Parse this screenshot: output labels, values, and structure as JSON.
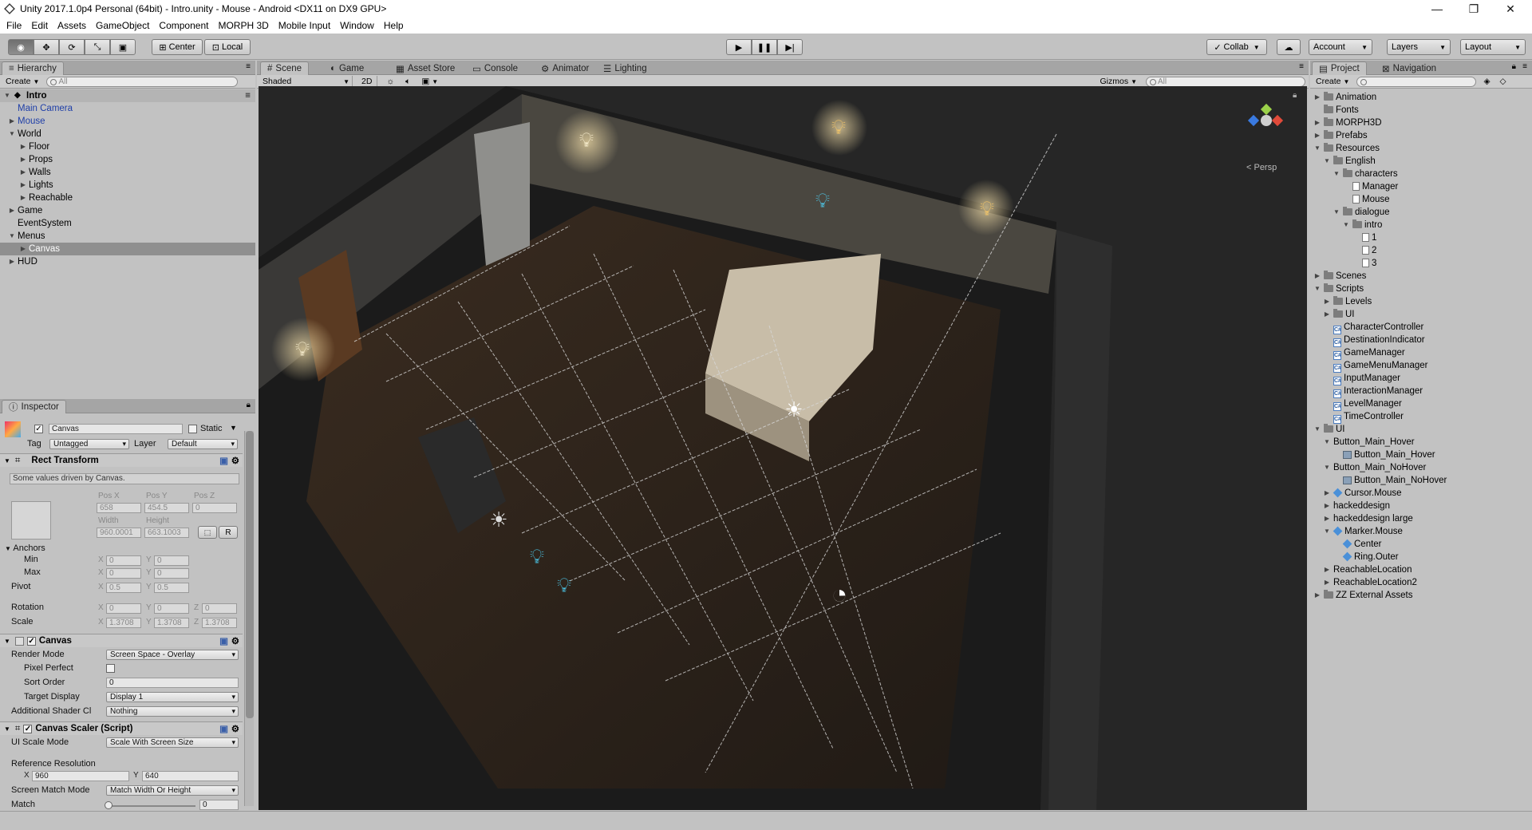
{
  "window": {
    "title": "Unity 2017.1.0p4 Personal (64bit) - Intro.unity - Mouse - Android <DX11 on DX9 GPU>"
  },
  "menu": [
    "File",
    "Edit",
    "Assets",
    "GameObject",
    "Component",
    "MORPH 3D",
    "Mobile Input",
    "Window",
    "Help"
  ],
  "toolbar": {
    "pivot_label": "Center",
    "space_label": "Local",
    "collab_label": "Collab",
    "account_label": "Account",
    "layers_label": "Layers",
    "layout_label": "Layout"
  },
  "hierarchy": {
    "tab": "Hierarchy",
    "create_label": "Create",
    "search_placeholder": "All",
    "scene_name": "Intro",
    "items": [
      {
        "label": "Main Camera",
        "depth": 1,
        "arrow": "",
        "cls": "blue"
      },
      {
        "label": "Mouse",
        "depth": 1,
        "arrow": "▶",
        "cls": "blue"
      },
      {
        "label": "World",
        "depth": 1,
        "arrow": "▼",
        "cls": ""
      },
      {
        "label": "Floor",
        "depth": 2,
        "arrow": "▶",
        "cls": ""
      },
      {
        "label": "Props",
        "depth": 2,
        "arrow": "▶",
        "cls": ""
      },
      {
        "label": "Walls",
        "depth": 2,
        "arrow": "▶",
        "cls": ""
      },
      {
        "label": "Lights",
        "depth": 2,
        "arrow": "▶",
        "cls": ""
      },
      {
        "label": "Reachable",
        "depth": 2,
        "arrow": "▶",
        "cls": ""
      },
      {
        "label": "Game",
        "depth": 1,
        "arrow": "▶",
        "cls": ""
      },
      {
        "label": "EventSystem",
        "depth": 1,
        "arrow": "",
        "cls": ""
      },
      {
        "label": "Menus",
        "depth": 1,
        "arrow": "▼",
        "cls": ""
      },
      {
        "label": "Canvas",
        "depth": 2,
        "arrow": "▶",
        "cls": "sel"
      },
      {
        "label": "HUD",
        "depth": 1,
        "arrow": "▶",
        "cls": ""
      }
    ]
  },
  "inspector": {
    "tab": "Inspector",
    "object_name": "Canvas",
    "static_label": "Static",
    "tag_label": "Tag",
    "tag_value": "Untagged",
    "layer_label": "Layer",
    "layer_value": "Default",
    "rect_transform": {
      "title": "Rect Transform",
      "note": "Some values driven by Canvas.",
      "pos_x_label": "Pos X",
      "pos_y_label": "Pos Y",
      "pos_z_label": "Pos Z",
      "pos_x": "658",
      "pos_y": "454.5",
      "pos_z": "0",
      "width_label": "Width",
      "height_label": "Height",
      "width": "960.0001",
      "height": "663.1003",
      "r_label": "R",
      "anchors_label": "Anchors",
      "min_label": "Min",
      "max_label": "Max",
      "min_x": "0",
      "min_y": "0",
      "max_x": "0",
      "max_y": "0",
      "pivot_label": "Pivot",
      "pivot_x": "0.5",
      "pivot_y": "0.5",
      "rotation_label": "Rotation",
      "rot_x": "0",
      "rot_y": "0",
      "rot_z": "0",
      "scale_label": "Scale",
      "scale_x": "1.3708",
      "scale_y": "1.3708",
      "scale_z": "1.3708",
      "x": "X",
      "y": "Y",
      "z": "Z"
    },
    "canvas": {
      "title": "Canvas",
      "render_mode_label": "Render Mode",
      "render_mode": "Screen Space - Overlay",
      "pixel_perfect_label": "Pixel Perfect",
      "sort_order_label": "Sort Order",
      "sort_order": "0",
      "target_display_label": "Target Display",
      "target_display": "Display 1",
      "shader_label": "Additional Shader Cl",
      "shader_value": "Nothing"
    },
    "scaler": {
      "title": "Canvas Scaler (Script)",
      "ui_scale_label": "UI Scale Mode",
      "ui_scale": "Scale With Screen Size",
      "ref_res_label": "Reference Resolution",
      "ref_x": "960",
      "ref_y": "640",
      "match_mode_label": "Screen Match Mode",
      "match_mode": "Match Width Or Height",
      "match_label": "Match",
      "match_value": "0"
    }
  },
  "scene_view": {
    "tabs": [
      {
        "label": "Scene",
        "icon": "#"
      },
      {
        "label": "Game",
        "icon": "◐"
      },
      {
        "label": "Asset Store",
        "icon": "▦"
      },
      {
        "label": "Console",
        "icon": "▭"
      },
      {
        "label": "Animator",
        "icon": "⚙"
      },
      {
        "label": "Lighting",
        "icon": "☰"
      }
    ],
    "shading": "Shaded",
    "mode_2d": "2D",
    "gizmos_label": "Gizmos",
    "search_placeholder": "All",
    "persp_label": "< Persp"
  },
  "project": {
    "tab": "Project",
    "nav_tab": "Navigation",
    "create_label": "Create",
    "items": [
      {
        "label": "Animation",
        "depth": 0,
        "arrow": "▶",
        "icon": "folder"
      },
      {
        "label": "Fonts",
        "depth": 0,
        "arrow": "",
        "icon": "folder"
      },
      {
        "label": "MORPH3D",
        "depth": 0,
        "arrow": "▶",
        "icon": "folder"
      },
      {
        "label": "Prefabs",
        "depth": 0,
        "arrow": "▶",
        "icon": "folder"
      },
      {
        "label": "Resources",
        "depth": 0,
        "arrow": "▼",
        "icon": "folder"
      },
      {
        "label": "English",
        "depth": 1,
        "arrow": "▼",
        "icon": "folder"
      },
      {
        "label": "characters",
        "depth": 2,
        "arrow": "▼",
        "icon": "folder"
      },
      {
        "label": "Manager",
        "depth": 3,
        "arrow": "",
        "icon": "txt"
      },
      {
        "label": "Mouse",
        "depth": 3,
        "arrow": "",
        "icon": "txt"
      },
      {
        "label": "dialogue",
        "depth": 2,
        "arrow": "▼",
        "icon": "folder"
      },
      {
        "label": "intro",
        "depth": 3,
        "arrow": "▼",
        "icon": "folder"
      },
      {
        "label": "1",
        "depth": 4,
        "arrow": "",
        "icon": "txt"
      },
      {
        "label": "2",
        "depth": 4,
        "arrow": "",
        "icon": "txt"
      },
      {
        "label": "3",
        "depth": 4,
        "arrow": "",
        "icon": "txt"
      },
      {
        "label": "Scenes",
        "depth": 0,
        "arrow": "▶",
        "icon": "folder"
      },
      {
        "label": "Scripts",
        "depth": 0,
        "arrow": "▼",
        "icon": "folder"
      },
      {
        "label": "Levels",
        "depth": 1,
        "arrow": "▶",
        "icon": "folder"
      },
      {
        "label": "UI",
        "depth": 1,
        "arrow": "▶",
        "icon": "folder"
      },
      {
        "label": "CharacterController",
        "depth": 1,
        "arrow": "",
        "icon": "cs"
      },
      {
        "label": "DestinationIndicator",
        "depth": 1,
        "arrow": "",
        "icon": "cs"
      },
      {
        "label": "GameManager",
        "depth": 1,
        "arrow": "",
        "icon": "cs"
      },
      {
        "label": "GameMenuManager",
        "depth": 1,
        "arrow": "",
        "icon": "cs"
      },
      {
        "label": "InputManager",
        "depth": 1,
        "arrow": "",
        "icon": "cs"
      },
      {
        "label": "InteractionManager",
        "depth": 1,
        "arrow": "",
        "icon": "cs"
      },
      {
        "label": "LevelManager",
        "depth": 1,
        "arrow": "",
        "icon": "cs"
      },
      {
        "label": "TimeController",
        "depth": 1,
        "arrow": "",
        "icon": "cs"
      },
      {
        "label": "UI",
        "depth": 0,
        "arrow": "▼",
        "icon": "folder"
      },
      {
        "label": "Button_Main_Hover",
        "depth": 1,
        "arrow": "▼",
        "icon": ""
      },
      {
        "label": "Button_Main_Hover",
        "depth": 2,
        "arrow": "",
        "icon": "img"
      },
      {
        "label": "Button_Main_NoHover",
        "depth": 1,
        "arrow": "▼",
        "icon": ""
      },
      {
        "label": "Button_Main_NoHover",
        "depth": 2,
        "arrow": "",
        "icon": "img"
      },
      {
        "label": "Cursor.Mouse",
        "depth": 1,
        "arrow": "▶",
        "icon": "cube"
      },
      {
        "label": "hackeddesign",
        "depth": 1,
        "arrow": "▶",
        "icon": ""
      },
      {
        "label": "hackeddesign large",
        "depth": 1,
        "arrow": "▶",
        "icon": ""
      },
      {
        "label": "Marker.Mouse",
        "depth": 1,
        "arrow": "▼",
        "icon": "cube"
      },
      {
        "label": "Center",
        "depth": 2,
        "arrow": "",
        "icon": "cube"
      },
      {
        "label": "Ring.Outer",
        "depth": 2,
        "arrow": "",
        "icon": "cube"
      },
      {
        "label": "ReachableLocation",
        "depth": 1,
        "arrow": "▶",
        "icon": ""
      },
      {
        "label": "ReachableLocation2",
        "depth": 1,
        "arrow": "▶",
        "icon": ""
      },
      {
        "label": "ZZ External Assets",
        "depth": 0,
        "arrow": "▶",
        "icon": "folder"
      }
    ]
  }
}
